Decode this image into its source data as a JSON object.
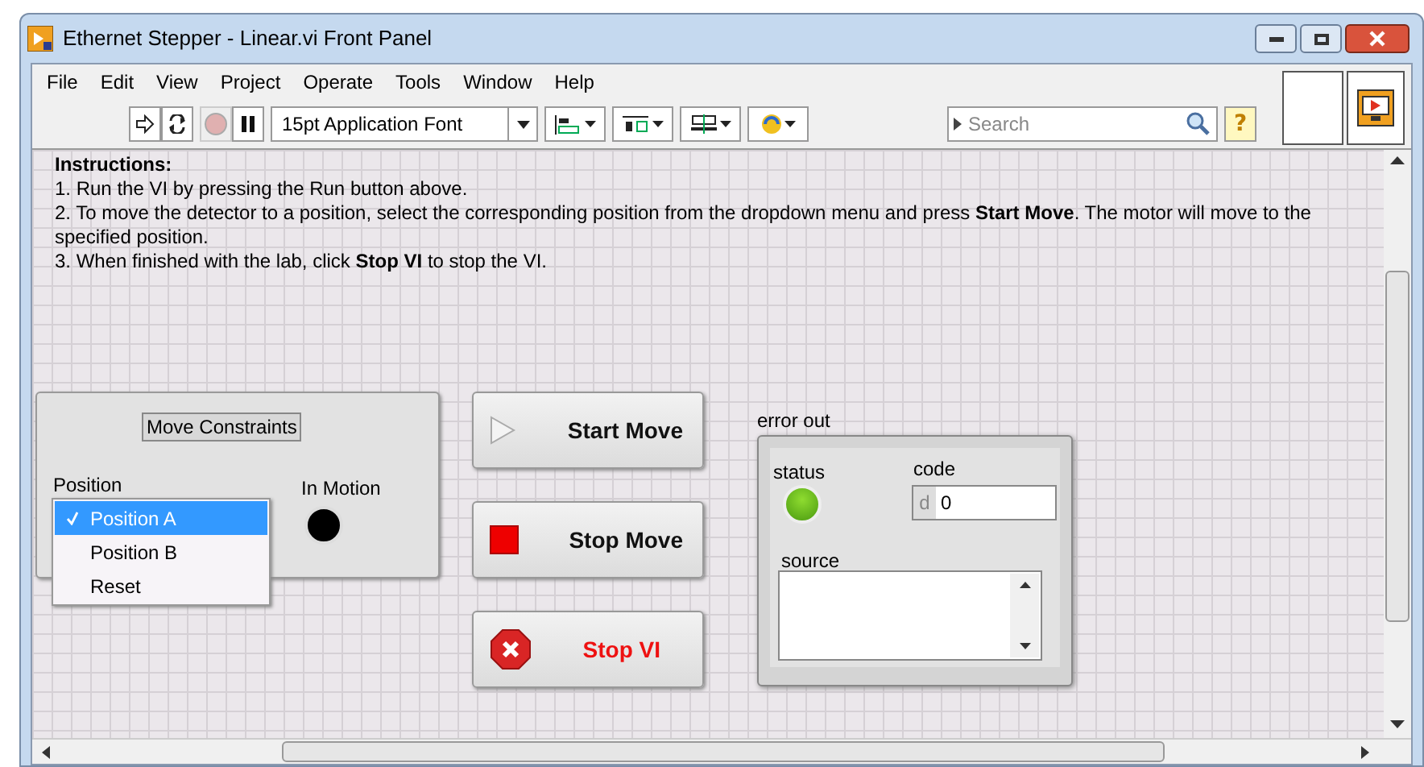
{
  "window": {
    "title": "Ethernet Stepper - Linear.vi Front Panel"
  },
  "menu": [
    "File",
    "Edit",
    "View",
    "Project",
    "Operate",
    "Tools",
    "Window",
    "Help"
  ],
  "toolbar": {
    "font": "15pt Application Font",
    "search": {
      "placeholder": "Search"
    },
    "help": "?"
  },
  "instructions": {
    "heading": "Instructions:",
    "lines": [
      "1. Run the VI by pressing the Run button above.",
      "2. To move the detector to a position, select the corresponding position from the dropdown menu and press **Start Move**. The motor will move to the specified position.",
      "3. When finished with the lab, click **Stop VI** to stop the VI."
    ]
  },
  "cluster": {
    "label": "Move Constraints",
    "position_label": "Position",
    "options": [
      {
        "label": "Position A",
        "selected": true
      },
      {
        "label": "Position B",
        "selected": false
      },
      {
        "label": "Reset",
        "selected": false
      }
    ],
    "indicator": {
      "label": "In Motion",
      "on": false
    }
  },
  "buttons": [
    {
      "kind": "start",
      "label": "Start Move"
    },
    {
      "kind": "stop",
      "label": "Stop Move"
    },
    {
      "kind": "stopvi",
      "label": "Stop VI"
    }
  ],
  "error_out": {
    "label": "error out",
    "status_label": "status",
    "status": true,
    "code_label": "code",
    "radix": "d",
    "code": "0",
    "source_label": "source"
  }
}
